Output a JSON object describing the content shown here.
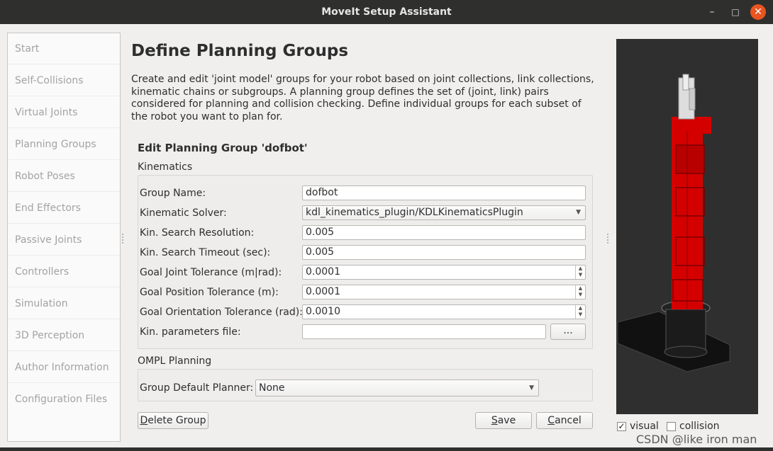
{
  "window": {
    "title": "MoveIt Setup Assistant",
    "controls": {
      "minimize": "–",
      "maximize": "□",
      "close": "✕"
    }
  },
  "sidebar": {
    "items": [
      {
        "label": "Start"
      },
      {
        "label": "Self-Collisions"
      },
      {
        "label": "Virtual Joints"
      },
      {
        "label": "Planning Groups"
      },
      {
        "label": "Robot Poses"
      },
      {
        "label": "End Effectors"
      },
      {
        "label": "Passive Joints"
      },
      {
        "label": "Controllers"
      },
      {
        "label": "Simulation"
      },
      {
        "label": "3D Perception"
      },
      {
        "label": "Author Information"
      },
      {
        "label": "Configuration Files"
      }
    ]
  },
  "main": {
    "title": "Define Planning Groups",
    "description": "Create and edit 'joint model' groups for your robot based on joint collections, link collections, kinematic chains or subgroups. A planning group defines the set of (joint, link) pairs considered for planning and collision checking. Define individual groups for each subset of the robot you want to plan for.",
    "edit_title": "Edit Planning Group 'dofbot'",
    "kinematics": {
      "section_label": "Kinematics",
      "group_name_label": "Group Name:",
      "group_name_value": "dofbot",
      "solver_label": "Kinematic Solver:",
      "solver_value": "kdl_kinematics_plugin/KDLKinematicsPlugin",
      "search_resolution_label": "Kin. Search Resolution:",
      "search_resolution_value": "0.005",
      "search_timeout_label": "Kin. Search Timeout (sec):",
      "search_timeout_value": "0.005",
      "goal_joint_label": "Goal Joint Tolerance (m|rad):",
      "goal_joint_value": "0.0001",
      "goal_position_label": "Goal Position Tolerance (m):",
      "goal_position_value": "0.0001",
      "goal_orientation_label": "Goal Orientation Tolerance (rad):",
      "goal_orientation_value": "0.0010",
      "params_file_label": "Kin. parameters file:",
      "params_file_value": "",
      "browse_label": "..."
    },
    "ompl": {
      "section_label": "OMPL Planning",
      "planner_label": "Group Default Planner:",
      "planner_value": "None"
    },
    "buttons": {
      "delete_prefix": "D",
      "delete_rest": "elete Group",
      "save_prefix": "S",
      "save_rest": "ave",
      "cancel_prefix": "C",
      "cancel_rest": "ancel"
    }
  },
  "viewer": {
    "visual_label": "visual",
    "visual_checked": true,
    "collision_label": "collision",
    "collision_checked": false
  },
  "watermark": "CSDN @like iron man",
  "colors": {
    "titlebar": "#2f2f2d",
    "close_button": "#e95420",
    "viewer_background": "#2f2f2f",
    "robot_red": "#d40000"
  }
}
